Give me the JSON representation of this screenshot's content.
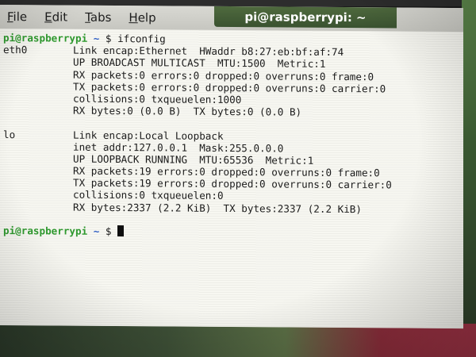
{
  "window": {
    "title": "pi@raspberrypi: ~",
    "menu": [
      {
        "accel": "F",
        "rest": "ile"
      },
      {
        "accel": "E",
        "rest": "dit"
      },
      {
        "accel": "T",
        "rest": "abs"
      },
      {
        "accel": "H",
        "rest": "elp"
      }
    ]
  },
  "terminal": {
    "prompt_user": "pi@raspberrypi",
    "prompt_sep": " ",
    "prompt_cwd": "~",
    "prompt_symbol": " $ ",
    "command": "ifconfig",
    "interfaces": [
      {
        "name": "eth0",
        "lines": [
          "Link encap:Ethernet  HWaddr b8:27:eb:bf:af:74",
          "UP BROADCAST MULTICAST  MTU:1500  Metric:1",
          "RX packets:0 errors:0 dropped:0 overruns:0 frame:0",
          "TX packets:0 errors:0 dropped:0 overruns:0 carrier:0",
          "collisions:0 txqueuelen:1000",
          "RX bytes:0 (0.0 B)  TX bytes:0 (0.0 B)"
        ]
      },
      {
        "name": "lo",
        "lines": [
          "Link encap:Local Loopback",
          "inet addr:127.0.0.1  Mask:255.0.0.0",
          "UP LOOPBACK RUNNING  MTU:65536  Metric:1",
          "RX packets:19 errors:0 dropped:0 overruns:0 frame:0",
          "TX packets:19 errors:0 dropped:0 overruns:0 carrier:0",
          "collisions:0 txqueuelen:0",
          "RX bytes:2337 (2.2 KiB)  TX bytes:2337 (2.2 KiB)"
        ]
      }
    ]
  },
  "colors": {
    "prompt_user": "#2f9a2f",
    "prompt_cwd": "#2f5fc7",
    "terminal_bg": "#f7f7f1",
    "terminal_fg": "#1b1b1b"
  }
}
